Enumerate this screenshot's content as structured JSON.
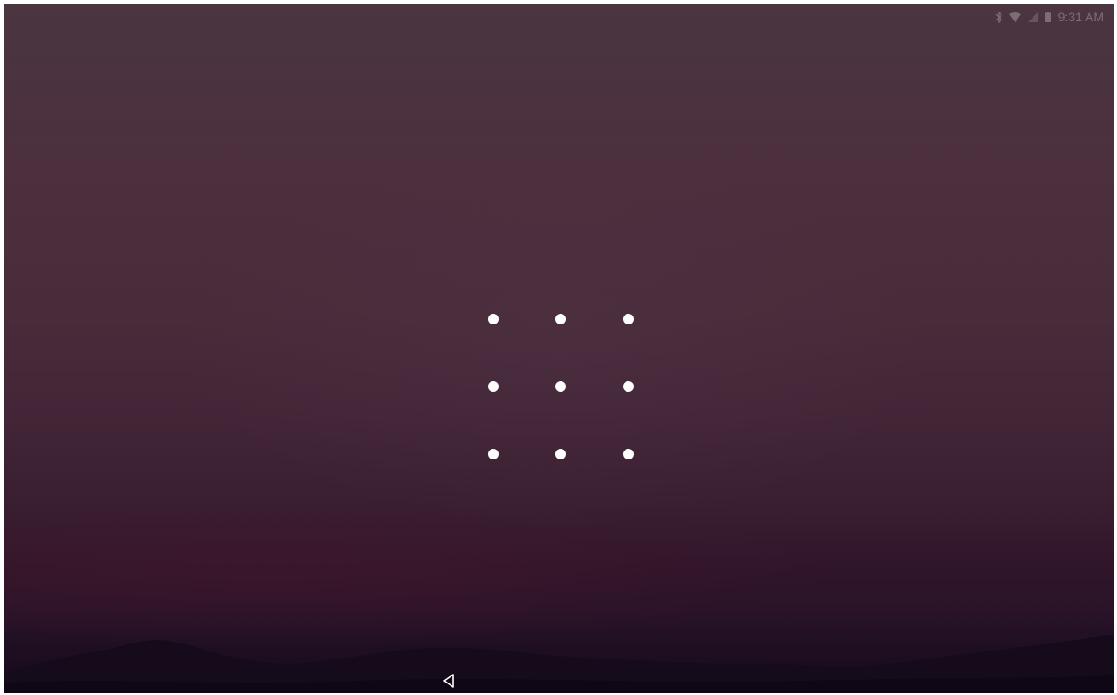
{
  "status_bar": {
    "time": "9:31 AM",
    "icons": [
      "bluetooth-icon",
      "wifi-icon",
      "signal-icon",
      "battery-icon"
    ]
  },
  "lock_screen": {
    "type": "pattern",
    "rows": 3,
    "cols": 3
  },
  "nav_bar": {
    "buttons": [
      "back-icon"
    ]
  },
  "colors": {
    "dot": "#ffffff",
    "sky_top": "#4a3540",
    "sky_bottom": "#140a18",
    "hills": "#160b1a"
  }
}
